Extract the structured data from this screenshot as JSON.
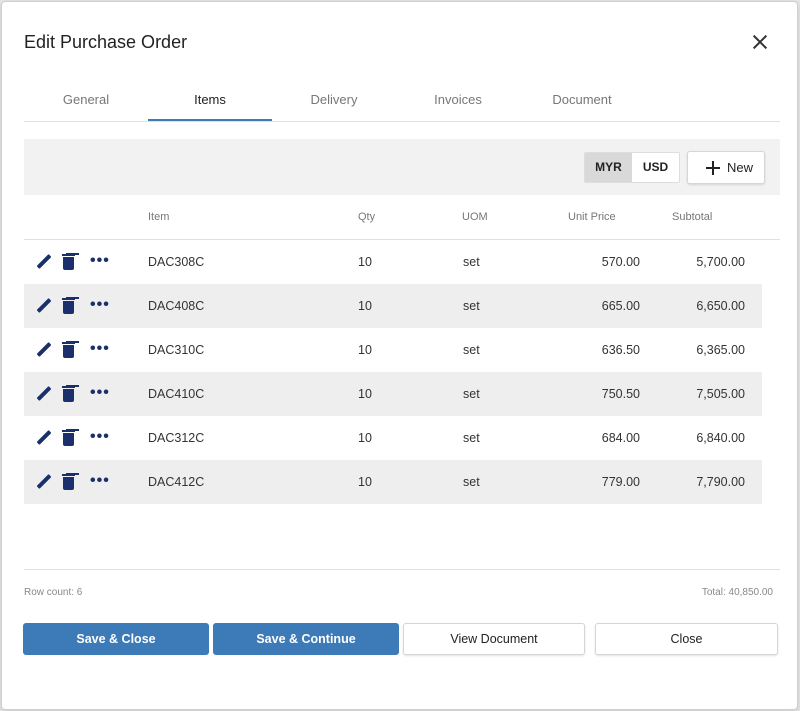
{
  "dialog": {
    "title": "Edit Purchase Order"
  },
  "tabs": [
    {
      "label": "General"
    },
    {
      "label": "Items"
    },
    {
      "label": "Delivery"
    },
    {
      "label": "Invoices"
    },
    {
      "label": "Document"
    }
  ],
  "active_tab": "Items",
  "toolbar": {
    "currencies": [
      "MYR",
      "USD"
    ],
    "active_currency": "MYR",
    "new_label": "New"
  },
  "table": {
    "columns": [
      "Item",
      "Qty",
      "UOM",
      "Unit Price",
      "Subtotal"
    ],
    "rows": [
      {
        "item": "DAC308C",
        "qty": "10",
        "uom": "set",
        "unit_price": "570.00",
        "subtotal": "5,700.00"
      },
      {
        "item": "DAC408C",
        "qty": "10",
        "uom": "set",
        "unit_price": "665.00",
        "subtotal": "6,650.00"
      },
      {
        "item": "DAC310C",
        "qty": "10",
        "uom": "set",
        "unit_price": "636.50",
        "subtotal": "6,365.00"
      },
      {
        "item": "DAC410C",
        "qty": "10",
        "uom": "set",
        "unit_price": "750.50",
        "subtotal": "7,505.00"
      },
      {
        "item": "DAC312C",
        "qty": "10",
        "uom": "set",
        "unit_price": "684.00",
        "subtotal": "6,840.00"
      },
      {
        "item": "DAC412C",
        "qty": "10",
        "uom": "set",
        "unit_price": "779.00",
        "subtotal": "7,790.00"
      }
    ]
  },
  "footer": {
    "row_count": "Row count: 6",
    "total": "Total: 40,850.00"
  },
  "buttons": {
    "save_close": "Save & Close",
    "save_continue": "Save & Continue",
    "view_document": "View Document",
    "close": "Close"
  },
  "icons": {
    "row_edit": "pencil-icon",
    "row_delete": "trash-icon",
    "row_more": "more-horizontal-icon",
    "dialog_close": "close-icon",
    "new": "plus-icon"
  },
  "colors": {
    "primary": "#3d7ab8",
    "icon": "#1a2f6b",
    "row_alt": "#eeeeee"
  }
}
